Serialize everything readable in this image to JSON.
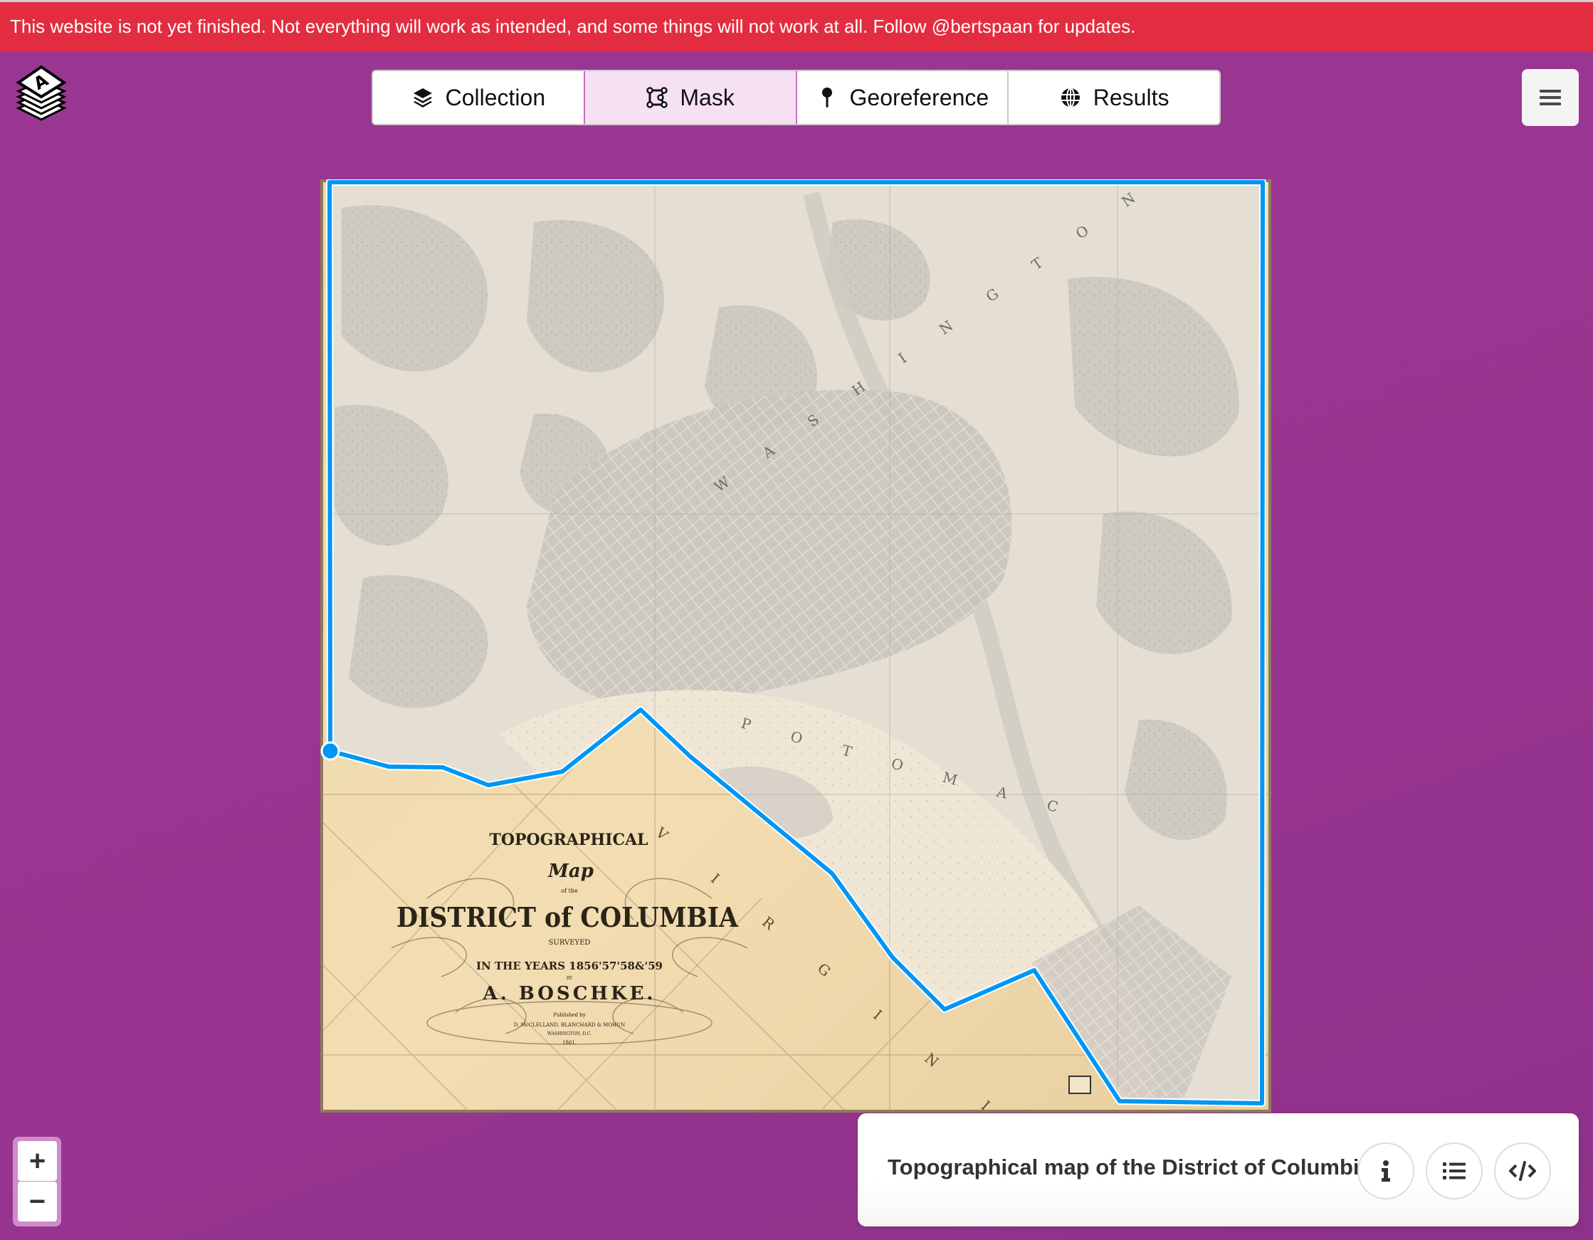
{
  "banner": {
    "text": "This website is not yet finished. Not everything will work as intended, and some things will not work at all. Follow @bertspaan for updates."
  },
  "colors": {
    "banner_bg": "#e22d40",
    "app_bg": "#983590",
    "active_tab_bg": "#f5e1f3",
    "mask_line": "#0096f5",
    "map_outside_mask": "#e6e0d4",
    "map_inside_mask": "#efdcb4"
  },
  "logo": {
    "icon": "allmaps-stack-logo"
  },
  "tabs": [
    {
      "label": "Collection",
      "icon": "layers-icon",
      "active": false
    },
    {
      "label": "Mask",
      "icon": "polygon-mask-icon",
      "active": true
    },
    {
      "label": "Georeference",
      "icon": "map-pin-icon",
      "active": false
    },
    {
      "label": "Results",
      "icon": "globe-icon",
      "active": false
    }
  ],
  "menu": {
    "icon": "hamburger-icon"
  },
  "map": {
    "labels": {
      "title_line1": "TOPOGRAPHICAL",
      "title_line2": "Map",
      "title_line3": "of the",
      "title_line4": "DISTRICT of COLUMBIA",
      "title_line5": "SURVEYED",
      "title_line6": "IN THE YEARS 1856'57'58&'59",
      "title_line7": "BY",
      "title_line8": "A. BOSCHKE.",
      "title_line9": "Published by",
      "title_line10": "D. McCLELLAND, BLANCHARD & MOHUN",
      "title_line11": "WASHINGTON, D.C.",
      "title_line12": "1861.",
      "river": "P O T O M A C",
      "city": "W A S H I N G T O N",
      "state": "V I R G I N I A"
    },
    "mask_vertex_count": 15
  },
  "zoom": {
    "in_label": "+",
    "out_label": "−"
  },
  "info_panel": {
    "title": "Topographical map of the District of Columbia",
    "buttons": [
      {
        "name": "info",
        "icon": "info-icon"
      },
      {
        "name": "list",
        "icon": "list-icon"
      },
      {
        "name": "code",
        "icon": "code-icon"
      }
    ]
  }
}
